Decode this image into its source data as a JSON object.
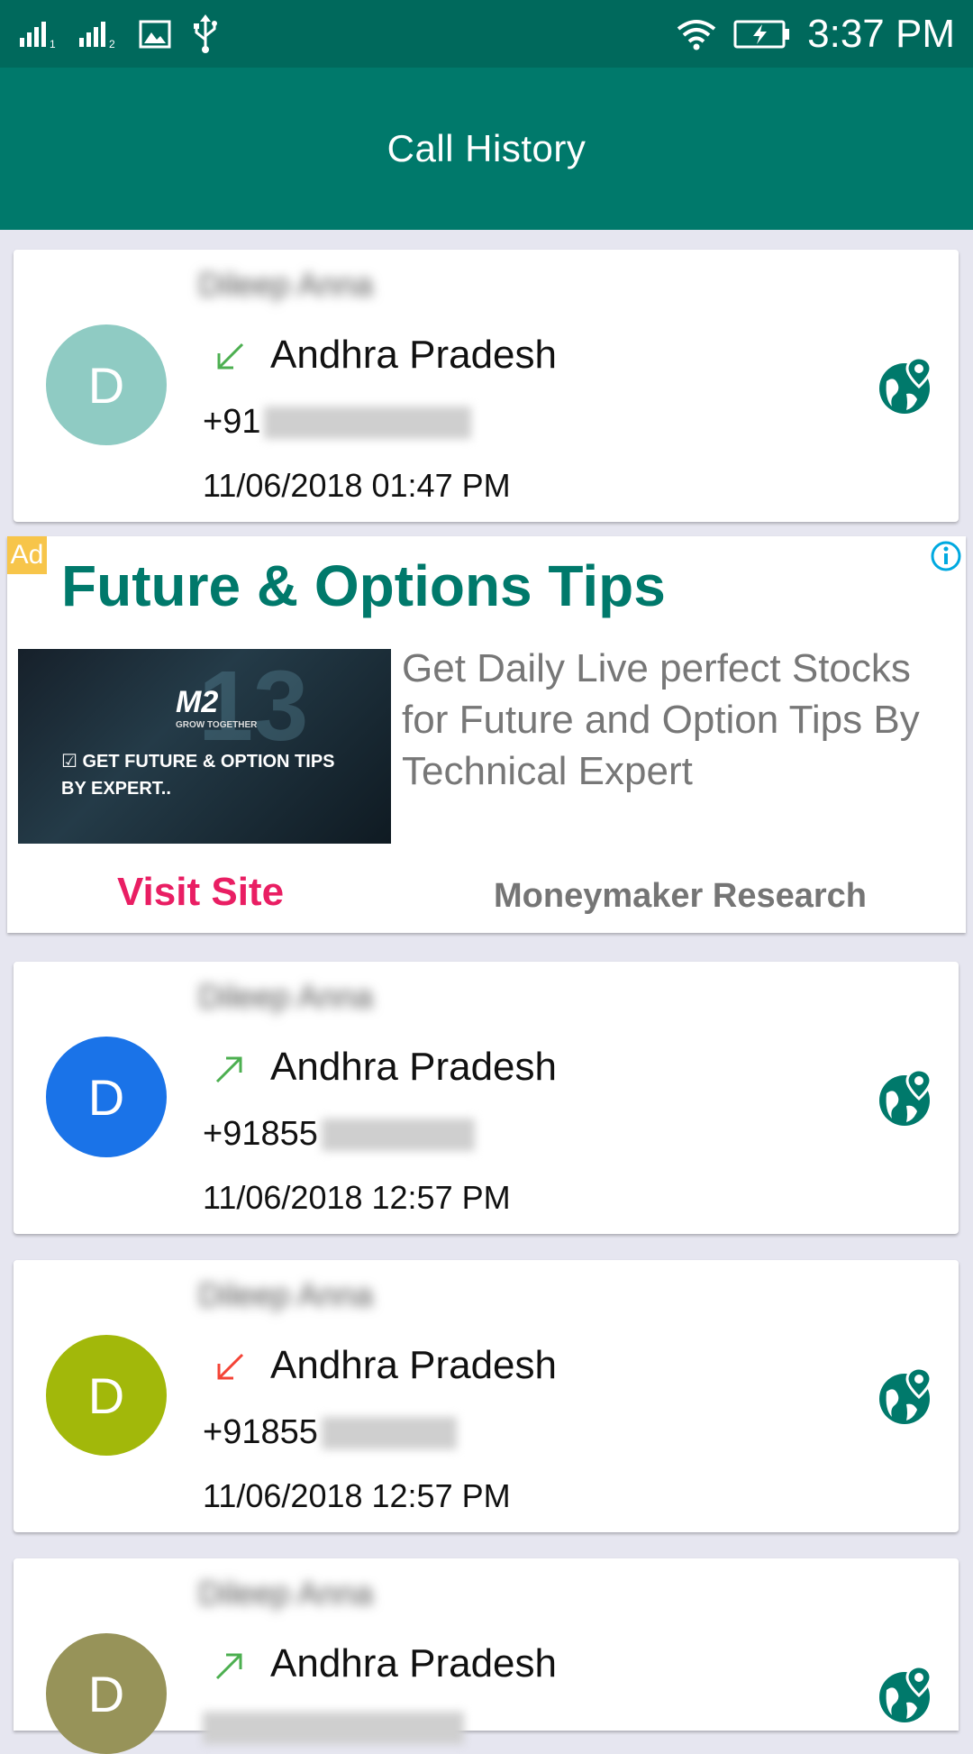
{
  "status_bar": {
    "time": "3:37 PM",
    "left_icons": [
      "signal-sim1-icon",
      "signal-sim2-icon",
      "image-icon",
      "usb-icon"
    ],
    "right_icons": [
      "wifi-icon",
      "battery-charging-icon"
    ]
  },
  "app_bar": {
    "title": "Call History"
  },
  "calls": [
    {
      "avatar_letter": "D",
      "avatar_color": "#8fcbc3",
      "name": "Dileep Anna",
      "call_type": "incoming",
      "arrow_color": "#4caf50",
      "region": "Andhra Pradesh",
      "phone_prefix": "+91",
      "datetime": "11/06/2018 01:47 PM"
    },
    {
      "avatar_letter": "D",
      "avatar_color": "#1a73e8",
      "name": "Dileep Anna",
      "call_type": "outgoing",
      "arrow_color": "#4caf50",
      "region": "Andhra Pradesh",
      "phone_prefix": "+91855",
      "datetime": "11/06/2018 12:57 PM"
    },
    {
      "avatar_letter": "D",
      "avatar_color": "#a2b80a",
      "name": "Dileep Anna",
      "call_type": "missed",
      "arrow_color": "#f44336",
      "region": "Andhra Pradesh",
      "phone_prefix": "+91855",
      "datetime": "11/06/2018 12:57 PM"
    },
    {
      "avatar_letter": "D",
      "avatar_color": "#979359",
      "name": "Dileep Anna",
      "call_type": "outgoing",
      "arrow_color": "#4caf50",
      "region": "Andhra Pradesh",
      "phone_prefix": "",
      "datetime": ""
    }
  ],
  "ad": {
    "badge": "Ad",
    "title": "Future & Options Tips",
    "image_text": "GET FUTURE & OPTION TIPS\nBY EXPERT..",
    "image_logo": "M2",
    "image_logo_sub": "GROW TOGETHER",
    "description": "Get Daily Live perfect Stocks for Future and Option Tips By Technical Expert",
    "cta": "Visit Site",
    "advertiser": "Moneymaker Research"
  },
  "colors": {
    "status_bar": "#00695c",
    "app_bar": "#00796b",
    "accent": "#00796b",
    "cta": "#e91e63"
  }
}
